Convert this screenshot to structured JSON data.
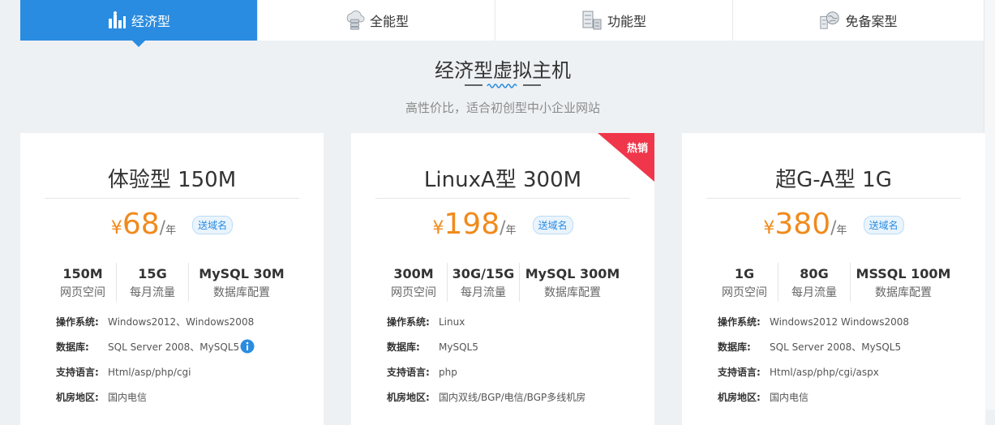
{
  "tabs": [
    {
      "label": "经济型",
      "icon": "chart-bar-icon",
      "active": true
    },
    {
      "label": "全能型",
      "icon": "cloud-server-icon",
      "active": false
    },
    {
      "label": "功能型",
      "icon": "server-rack-icon",
      "active": false
    },
    {
      "label": "免备案型",
      "icon": "globe-server-icon",
      "active": false
    }
  ],
  "section": {
    "title": "经济型虚拟主机",
    "subtitle": "高性价比，适合初创型中小企业网站"
  },
  "cards": [
    {
      "name": "体验型 150M",
      "currency": "¥",
      "price": "68",
      "unit": "年",
      "gift": "送域名",
      "hot": false,
      "specs": [
        {
          "value": "150M",
          "label": "网页空间"
        },
        {
          "value": "15G",
          "label": "每月流量"
        },
        {
          "value": "MySQL 30M",
          "label": "数据库配置"
        }
      ],
      "details": [
        {
          "key": "操作系统:",
          "value": "Windows2012、Windows2008"
        },
        {
          "key": "数据库:",
          "value": "SQL Server 2008、MySQL5"
        },
        {
          "key": "支持语言:",
          "value": "Html/asp/php/cgi"
        },
        {
          "key": "机房地区:",
          "value": "国内电信"
        }
      ]
    },
    {
      "name": "LinuxA型 300M",
      "currency": "¥",
      "price": "198",
      "unit": "年",
      "gift": "送域名",
      "hot": true,
      "hot_label": "热销",
      "specs": [
        {
          "value": "300M",
          "label": "网页空间"
        },
        {
          "value": "30G/15G",
          "label": "每月流量"
        },
        {
          "value": "MySQL 300M",
          "label": "数据库配置"
        }
      ],
      "details": [
        {
          "key": "操作系统:",
          "value": "Linux"
        },
        {
          "key": "数据库:",
          "value": "MySQL5"
        },
        {
          "key": "支持语言:",
          "value": "php"
        },
        {
          "key": "机房地区:",
          "value": "国内双线/BGP/电信/BGP多线机房"
        }
      ]
    },
    {
      "name": "超G-A型 1G",
      "currency": "¥",
      "price": "380",
      "unit": "年",
      "gift": "送域名",
      "hot": false,
      "specs": [
        {
          "value": "1G",
          "label": "网页空间"
        },
        {
          "value": "80G",
          "label": "每月流量"
        },
        {
          "value": "MSSQL 100M",
          "label": "数据库配置"
        }
      ],
      "details": [
        {
          "key": "操作系统:",
          "value": "Windows2012 Windows2008"
        },
        {
          "key": "数据库:",
          "value": "SQL Server 2008、MySQL5"
        },
        {
          "key": "支持语言:",
          "value": "Html/asp/php/cgi/aspx"
        },
        {
          "key": "机房地区:",
          "value": "国内电信"
        }
      ]
    }
  ],
  "colors": {
    "accent": "#2a8ce0",
    "price": "#f08a1c",
    "hot": "#f0364a",
    "background": "#eef1f4"
  }
}
